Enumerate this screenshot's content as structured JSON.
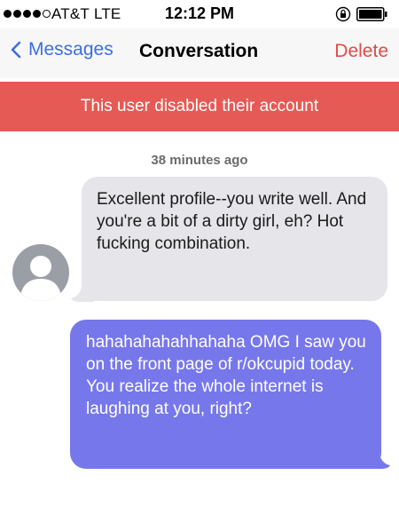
{
  "status_bar": {
    "carrier": "AT&T",
    "network": "LTE",
    "time": "12:12 PM",
    "signal_bars_filled": 4,
    "signal_bars_total": 5,
    "icons": [
      "rotation-lock-icon",
      "battery-icon"
    ]
  },
  "nav": {
    "back_label": "Messages",
    "title": "Conversation",
    "delete_label": "Delete"
  },
  "banner": {
    "text": "This user disabled their account"
  },
  "conversation": {
    "timestamp": "38 minutes ago",
    "messages": [
      {
        "direction": "incoming",
        "text": "Excellent profile--you write well. And you're a bit of a dirty girl, eh? Hot fucking combination."
      },
      {
        "direction": "outgoing",
        "text": "hahahahahahhahaha OMG I saw you on the front page of r/okcupid today. You realize the whole internet is laughing at you, right?"
      }
    ]
  },
  "colors": {
    "accent_blue": "#3c6fe0",
    "delete_red": "#e04c47",
    "banner_red": "#e65a55",
    "incoming_bubble": "#e5e5ea",
    "outgoing_bubble": "#7777ec"
  }
}
